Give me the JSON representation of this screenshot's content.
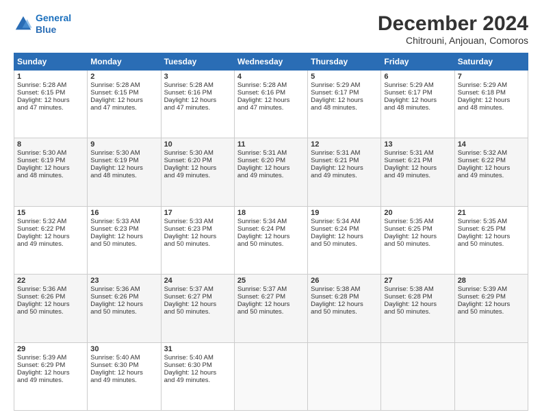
{
  "header": {
    "logo_line1": "General",
    "logo_line2": "Blue",
    "title": "December 2024",
    "subtitle": "Chitrouni, Anjouan, Comoros"
  },
  "calendar": {
    "weekdays": [
      "Sunday",
      "Monday",
      "Tuesday",
      "Wednesday",
      "Thursday",
      "Friday",
      "Saturday"
    ],
    "weeks": [
      [
        null,
        null,
        null,
        null,
        null,
        null,
        null
      ]
    ],
    "days": {
      "1": {
        "sunrise": "5:28 AM",
        "sunset": "6:15 PM",
        "daylight": "12 hours and 47 minutes."
      },
      "2": {
        "sunrise": "5:28 AM",
        "sunset": "6:15 PM",
        "daylight": "12 hours and 47 minutes."
      },
      "3": {
        "sunrise": "5:28 AM",
        "sunset": "6:16 PM",
        "daylight": "12 hours and 47 minutes."
      },
      "4": {
        "sunrise": "5:28 AM",
        "sunset": "6:16 PM",
        "daylight": "12 hours and 47 minutes."
      },
      "5": {
        "sunrise": "5:29 AM",
        "sunset": "6:17 PM",
        "daylight": "12 hours and 48 minutes."
      },
      "6": {
        "sunrise": "5:29 AM",
        "sunset": "6:17 PM",
        "daylight": "12 hours and 48 minutes."
      },
      "7": {
        "sunrise": "5:29 AM",
        "sunset": "6:18 PM",
        "daylight": "12 hours and 48 minutes."
      },
      "8": {
        "sunrise": "5:30 AM",
        "sunset": "6:19 PM",
        "daylight": "12 hours and 48 minutes."
      },
      "9": {
        "sunrise": "5:30 AM",
        "sunset": "6:19 PM",
        "daylight": "12 hours and 48 minutes."
      },
      "10": {
        "sunrise": "5:30 AM",
        "sunset": "6:20 PM",
        "daylight": "12 hours and 49 minutes."
      },
      "11": {
        "sunrise": "5:31 AM",
        "sunset": "6:20 PM",
        "daylight": "12 hours and 49 minutes."
      },
      "12": {
        "sunrise": "5:31 AM",
        "sunset": "6:21 PM",
        "daylight": "12 hours and 49 minutes."
      },
      "13": {
        "sunrise": "5:31 AM",
        "sunset": "6:21 PM",
        "daylight": "12 hours and 49 minutes."
      },
      "14": {
        "sunrise": "5:32 AM",
        "sunset": "6:22 PM",
        "daylight": "12 hours and 49 minutes."
      },
      "15": {
        "sunrise": "5:32 AM",
        "sunset": "6:22 PM",
        "daylight": "12 hours and 49 minutes."
      },
      "16": {
        "sunrise": "5:33 AM",
        "sunset": "6:23 PM",
        "daylight": "12 hours and 50 minutes."
      },
      "17": {
        "sunrise": "5:33 AM",
        "sunset": "6:23 PM",
        "daylight": "12 hours and 50 minutes."
      },
      "18": {
        "sunrise": "5:34 AM",
        "sunset": "6:24 PM",
        "daylight": "12 hours and 50 minutes."
      },
      "19": {
        "sunrise": "5:34 AM",
        "sunset": "6:24 PM",
        "daylight": "12 hours and 50 minutes."
      },
      "20": {
        "sunrise": "5:35 AM",
        "sunset": "6:25 PM",
        "daylight": "12 hours and 50 minutes."
      },
      "21": {
        "sunrise": "5:35 AM",
        "sunset": "6:25 PM",
        "daylight": "12 hours and 50 minutes."
      },
      "22": {
        "sunrise": "5:36 AM",
        "sunset": "6:26 PM",
        "daylight": "12 hours and 50 minutes."
      },
      "23": {
        "sunrise": "5:36 AM",
        "sunset": "6:26 PM",
        "daylight": "12 hours and 50 minutes."
      },
      "24": {
        "sunrise": "5:37 AM",
        "sunset": "6:27 PM",
        "daylight": "12 hours and 50 minutes."
      },
      "25": {
        "sunrise": "5:37 AM",
        "sunset": "6:27 PM",
        "daylight": "12 hours and 50 minutes."
      },
      "26": {
        "sunrise": "5:38 AM",
        "sunset": "6:28 PM",
        "daylight": "12 hours and 50 minutes."
      },
      "27": {
        "sunrise": "5:38 AM",
        "sunset": "6:28 PM",
        "daylight": "12 hours and 50 minutes."
      },
      "28": {
        "sunrise": "5:39 AM",
        "sunset": "6:29 PM",
        "daylight": "12 hours and 50 minutes."
      },
      "29": {
        "sunrise": "5:39 AM",
        "sunset": "6:29 PM",
        "daylight": "12 hours and 49 minutes."
      },
      "30": {
        "sunrise": "5:40 AM",
        "sunset": "6:30 PM",
        "daylight": "12 hours and 49 minutes."
      },
      "31": {
        "sunrise": "5:40 AM",
        "sunset": "6:30 PM",
        "daylight": "12 hours and 49 minutes."
      }
    }
  }
}
